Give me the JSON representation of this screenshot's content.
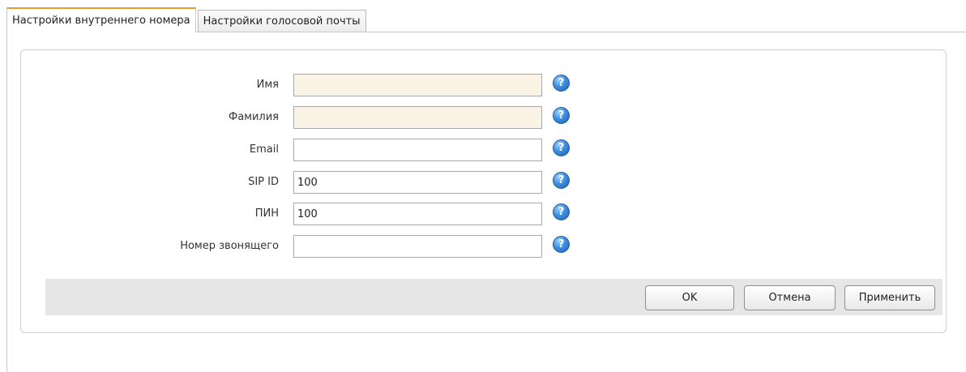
{
  "tabs": [
    {
      "label": "Настройки внутреннего номера",
      "active": true
    },
    {
      "label": "Настройки голосовой почты",
      "active": false
    }
  ],
  "fields": [
    {
      "label": "Имя",
      "value": "",
      "required": true
    },
    {
      "label": "Фамилия",
      "value": "",
      "required": true
    },
    {
      "label": "Email",
      "value": "",
      "required": false
    },
    {
      "label": "SIP ID",
      "value": "100",
      "required": false
    },
    {
      "label": "ПИН",
      "value": "100",
      "required": false
    },
    {
      "label": "Номер звонящего",
      "value": "",
      "required": false
    }
  ],
  "help_icon": {
    "glyph": "?",
    "icon": "question-help-icon",
    "color": "#3d8ee0"
  },
  "buttons": {
    "ok": "OK",
    "cancel": "Отмена",
    "apply": "Применить"
  },
  "colors": {
    "tab_accent": "#e79a36",
    "required_field_bg": "#fbf3e6",
    "footer_bg": "#e6e6e6"
  }
}
